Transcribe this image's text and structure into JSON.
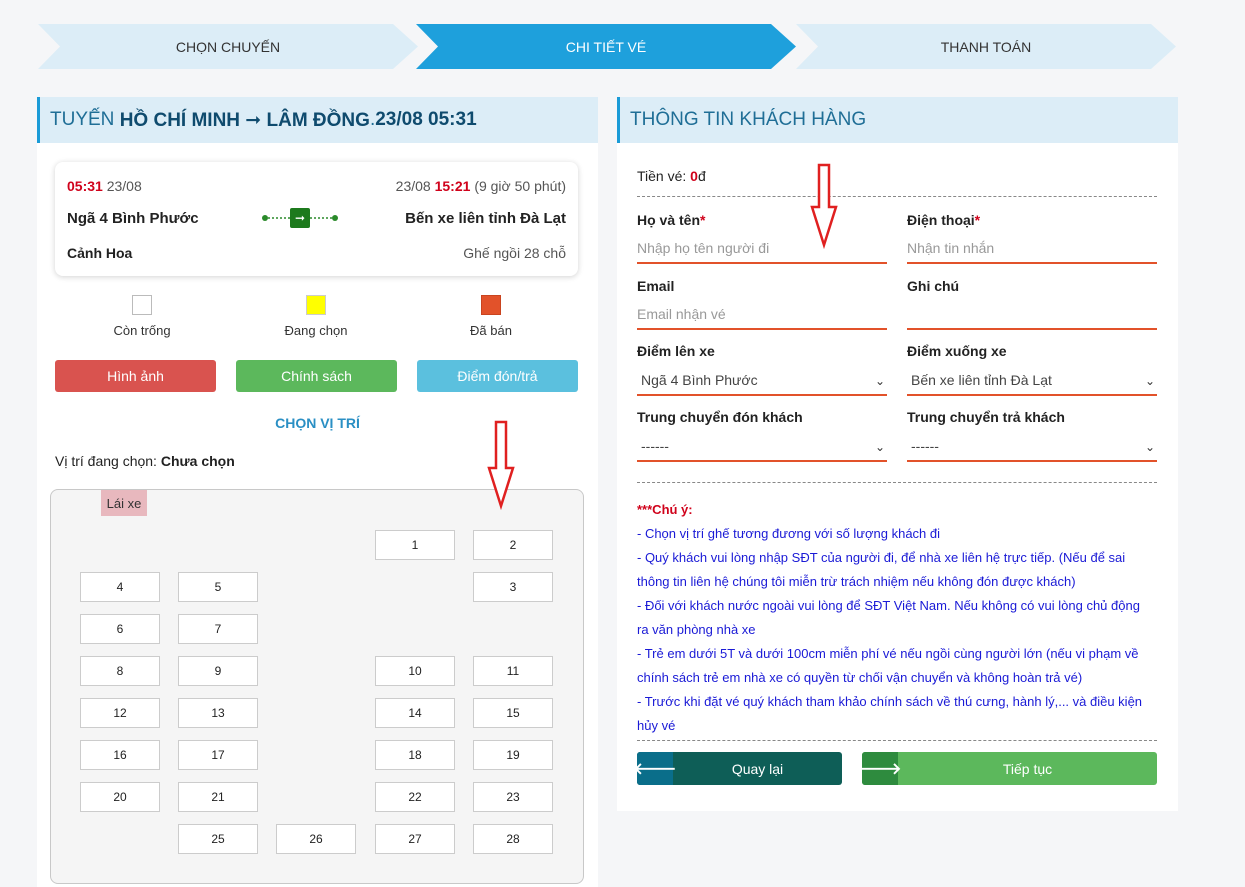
{
  "steps": [
    {
      "label": "CHỌN CHUYẾN"
    },
    {
      "label": "CHI TIẾT VÉ"
    },
    {
      "label": "THANH TOÁN"
    }
  ],
  "route": {
    "prefix": "TUYẾN ",
    "name": "HỒ CHÍ MINH ➞ LÂM ĐỒNG",
    "sep": ". ",
    "datetime": "23/08 05:31"
  },
  "trip": {
    "depart_time": "05:31",
    "depart_date": "23/08",
    "arrive_date": "23/08",
    "arrive_time": "15:21",
    "duration": "(9 giờ 50 phút)",
    "from": "Ngã 4 Bình Phước",
    "to": "Bến xe liên tỉnh Đà Lạt",
    "operator": "Cảnh Hoa",
    "seat_type": "Ghế ngồi 28 chỗ"
  },
  "legend": [
    {
      "label": "Còn trống",
      "color": "#ffffff"
    },
    {
      "label": "Đang chọn",
      "color": "#ffff00"
    },
    {
      "label": "Đã bán",
      "color": "#e2522a"
    }
  ],
  "buttons": {
    "images": "Hình ảnh",
    "policy": "Chính sách",
    "pickup": "Điểm đón/trả"
  },
  "seat_section": {
    "title": "CHỌN VỊ TRÍ",
    "current_label": "Vị trí đang chọn: ",
    "current_value": "Chưa chọn",
    "driver": "Lái xe"
  },
  "seats": [
    "1",
    "2",
    "3",
    "4",
    "5",
    "6",
    "7",
    "8",
    "9",
    "10",
    "11",
    "12",
    "13",
    "14",
    "15",
    "16",
    "17",
    "18",
    "19",
    "20",
    "21",
    "22",
    "23",
    "25",
    "26",
    "27",
    "28"
  ],
  "customer": {
    "title": "THÔNG TIN KHÁCH HÀNG",
    "price_label": "Tiền vé: ",
    "price_value": "0",
    "price_unit": "đ",
    "name_label": "Họ và tên",
    "name_placeholder": "Nhập họ tên người đi",
    "phone_label": "Điện thoại",
    "phone_placeholder": "Nhận tin nhắn",
    "required_mark": "*",
    "email_label": "Email",
    "email_placeholder": "Email nhận vé",
    "note_label": "Ghi chú",
    "board_label": "Điểm lên xe",
    "board_value": "Ngã 4 Bình Phước",
    "alight_label": "Điểm xuống xe",
    "alight_value": "Bến xe liên tỉnh Đà Lạt",
    "transfer_pick_label": "Trung chuyển đón khách",
    "transfer_pick_value": "------",
    "transfer_drop_label": "Trung chuyển trả khách",
    "transfer_drop_value": "------"
  },
  "notes": {
    "title": "***Chú ý:",
    "items": [
      "- Chọn vị trí ghế tương đương với số lượng khách đi",
      "- Quý khách vui lòng nhập SĐT của người đi, để nhà xe liên hệ trực tiếp. (Nếu để sai thông tin liên hệ chúng tôi miễn trừ trách nhiệm nếu không đón được khách)",
      "- Đối với khách nước ngoài vui lòng để SĐT Việt Nam. Nếu không có vui lòng chủ động ra văn phòng nhà xe",
      "- Trẻ em dưới 5T và dưới 100cm miễn phí vé nếu ngồi cùng người lớn (nếu vi phạm về chính sách trẻ em nhà xe có quyền từ chối vận chuyển và không hoàn trả vé)",
      "- Trước khi đặt vé quý khách tham khảo chính sách về thú cưng, hành lý,... và điều kiện hủy vé"
    ]
  },
  "actions": {
    "back": "Quay lại",
    "next": "Tiếp tục"
  }
}
